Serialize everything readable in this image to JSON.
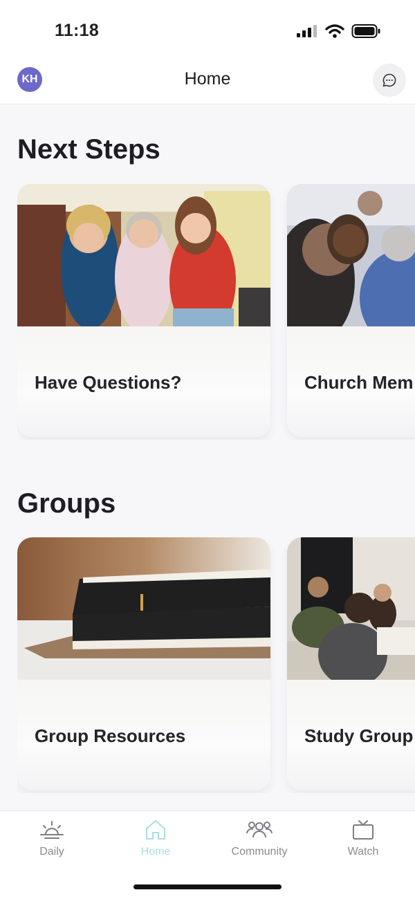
{
  "status_bar": {
    "time": "11:18"
  },
  "header": {
    "avatar_initials": "KH",
    "title": "Home"
  },
  "sections": [
    {
      "title": "Next Steps",
      "cards": [
        {
          "label": "Have Questions?",
          "image": "three smiling women photo"
        },
        {
          "label": "Church Mem",
          "image": "people in meeting photo"
        }
      ]
    },
    {
      "title": "Groups",
      "cards": [
        {
          "label": "Group Resources",
          "image": "bible on table photo"
        },
        {
          "label": "Study Group",
          "image": "group study dinner photo"
        }
      ]
    }
  ],
  "tab_bar": {
    "active": "Home",
    "tabs": [
      {
        "label": "Daily",
        "icon": "sunrise-icon"
      },
      {
        "label": "Home",
        "icon": "home-icon"
      },
      {
        "label": "Community",
        "icon": "people-icon"
      },
      {
        "label": "Watch",
        "icon": "tv-icon"
      }
    ]
  },
  "colors": {
    "avatar": "#6d69c9",
    "active_tab": "#a9dde0",
    "inactive_tab": "#8a8a90",
    "background": "#f7f7fa"
  }
}
